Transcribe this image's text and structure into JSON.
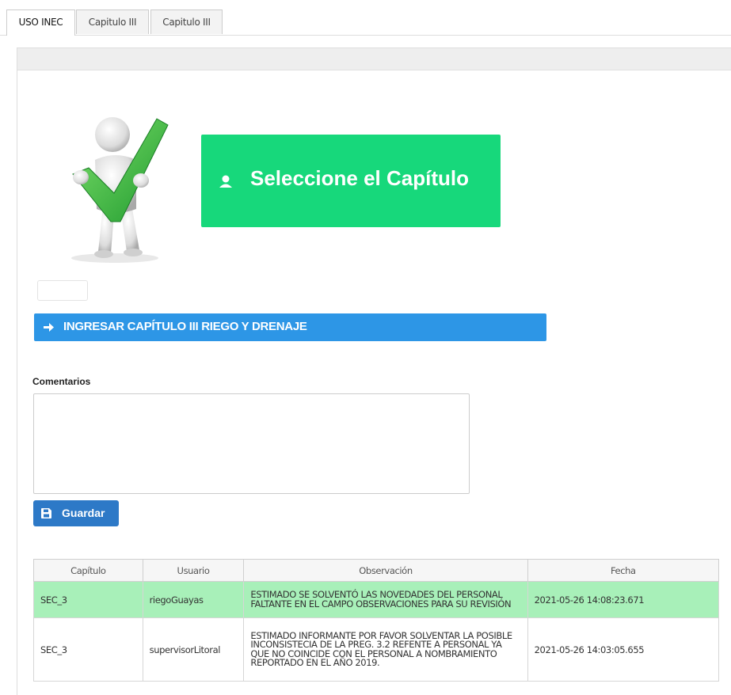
{
  "tabs": [
    {
      "label": "USO INEC",
      "active": true
    },
    {
      "label": "Capitulo III",
      "active": false
    },
    {
      "label": "Capitulo III",
      "active": false
    }
  ],
  "banner": {
    "text": "Seleccione el Capítulo",
    "icon": "user-icon",
    "color": "#17d87b"
  },
  "ingresar": {
    "label": "INGRESAR CAPÍTULO III RIEGO Y DRENAJE",
    "icon": "arrow-right-icon",
    "color": "#2d96e6"
  },
  "comentarios": {
    "label": "Comentarios",
    "value": ""
  },
  "guardar": {
    "label": "Guardar",
    "icon": "save-icon",
    "color": "#2d79c7"
  },
  "table": {
    "columns": [
      "Capítulo",
      "Usuario",
      "Observación",
      "Fecha"
    ],
    "rows": [
      {
        "capitulo": "SEC_3",
        "usuario": "riegoGuayas",
        "observacion": "ESTIMADO SE SOLVENTÓ LAS NOVEDADES DEL PERSONAL FALTANTE EN EL CAMPO OBSERVACIONES PARA SU REVISIÓN",
        "fecha": "2021-05-26 14:08:23.671",
        "highlight": true
      },
      {
        "capitulo": "SEC_3",
        "usuario": "supervisorLitoral",
        "observacion": "ESTIMADO INFORMANTE POR FAVOR SOLVENTAR LA POSIBLE INCONSISTECIA DE LA PREG. 3.2 REFENTE A PERSONAL YA QUE NO COINCIDE CON EL PERSONAL A NOMBRAMIENTO REPORTADO EN EL AÑO 2019.",
        "fecha": "2021-05-26 14:03:05.655",
        "highlight": false
      }
    ]
  }
}
